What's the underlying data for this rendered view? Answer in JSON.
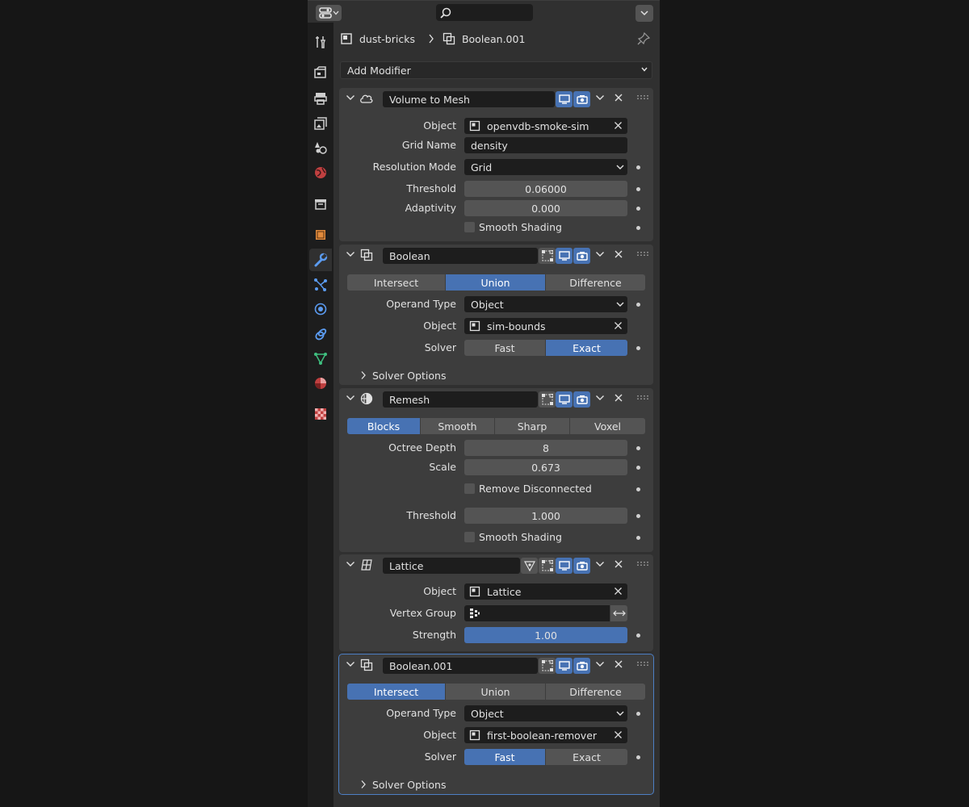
{
  "header": {
    "editor_type_icon": "properties-editor-icon",
    "search_icon": "search-icon",
    "search_value": "",
    "menu_icon": "chevron-down-icon"
  },
  "tabs": [
    {
      "name": "tool",
      "icon": "tool-icon"
    },
    {
      "name": "render",
      "icon": "render-icon"
    },
    {
      "name": "output",
      "icon": "output-icon"
    },
    {
      "name": "view-layer",
      "icon": "view-layer-icon"
    },
    {
      "name": "scene",
      "icon": "scene-icon"
    },
    {
      "name": "world",
      "icon": "world-icon"
    },
    {
      "name": "collection",
      "icon": "collection-icon"
    },
    {
      "name": "object",
      "icon": "object-icon"
    },
    {
      "name": "modifiers",
      "icon": "wrench-icon",
      "active": true
    },
    {
      "name": "particles",
      "icon": "particles-icon"
    },
    {
      "name": "physics",
      "icon": "physics-icon"
    },
    {
      "name": "constraints",
      "icon": "constraints-icon"
    },
    {
      "name": "data",
      "icon": "mesh-data-icon"
    },
    {
      "name": "material",
      "icon": "material-icon"
    },
    {
      "name": "texture",
      "icon": "texture-icon"
    }
  ],
  "breadcrumb": {
    "object": "dust-bricks",
    "modifier": "Boolean.001"
  },
  "add_modifier": "Add Modifier",
  "modifiers": {
    "volume_to_mesh": {
      "name": "Volume to Mesh",
      "object_label": "Object",
      "object_value": "openvdb-smoke-sim",
      "grid_name_label": "Grid Name",
      "grid_name_value": "density",
      "resolution_mode_label": "Resolution Mode",
      "resolution_mode_value": "Grid",
      "threshold_label": "Threshold",
      "threshold_value": "0.06000",
      "adaptivity_label": "Adaptivity",
      "adaptivity_value": "0.000",
      "smooth_shading_label": "Smooth Shading",
      "smooth_shading_checked": false
    },
    "boolean": {
      "name": "Boolean",
      "operations": [
        "Intersect",
        "Union",
        "Difference"
      ],
      "active_operation": "Union",
      "operand_type_label": "Operand Type",
      "operand_type_value": "Object",
      "object_label": "Object",
      "object_value": "sim-bounds",
      "solver_label": "Solver",
      "solvers": [
        "Fast",
        "Exact"
      ],
      "active_solver": "Exact",
      "solver_options_label": "Solver Options"
    },
    "remesh": {
      "name": "Remesh",
      "modes": [
        "Blocks",
        "Smooth",
        "Sharp",
        "Voxel"
      ],
      "active_mode": "Blocks",
      "octree_depth_label": "Octree Depth",
      "octree_depth_value": "8",
      "scale_label": "Scale",
      "scale_value": "0.673",
      "remove_disconnected_label": "Remove Disconnected",
      "remove_disconnected_checked": false,
      "threshold_label": "Threshold",
      "threshold_value": "1.000",
      "smooth_shading_label": "Smooth Shading",
      "smooth_shading_checked": false
    },
    "lattice": {
      "name": "Lattice",
      "object_label": "Object",
      "object_value": "Lattice",
      "vertex_group_label": "Vertex Group",
      "vertex_group_value": "",
      "strength_label": "Strength",
      "strength_value": "1.00",
      "strength_fraction": 1.0
    },
    "boolean_001": {
      "name": "Boolean.001",
      "operations": [
        "Intersect",
        "Union",
        "Difference"
      ],
      "active_operation": "Intersect",
      "operand_type_label": "Operand Type",
      "operand_type_value": "Object",
      "object_label": "Object",
      "object_value": "first-boolean-remover",
      "solver_label": "Solver",
      "solvers": [
        "Fast",
        "Exact"
      ],
      "active_solver": "Fast",
      "solver_options_label": "Solver Options"
    }
  },
  "colors": {
    "accent": "#4772b3",
    "panel": "#3d3d3d",
    "background": "#303030",
    "field_dark": "#1d1d1d",
    "field": "#545454"
  }
}
